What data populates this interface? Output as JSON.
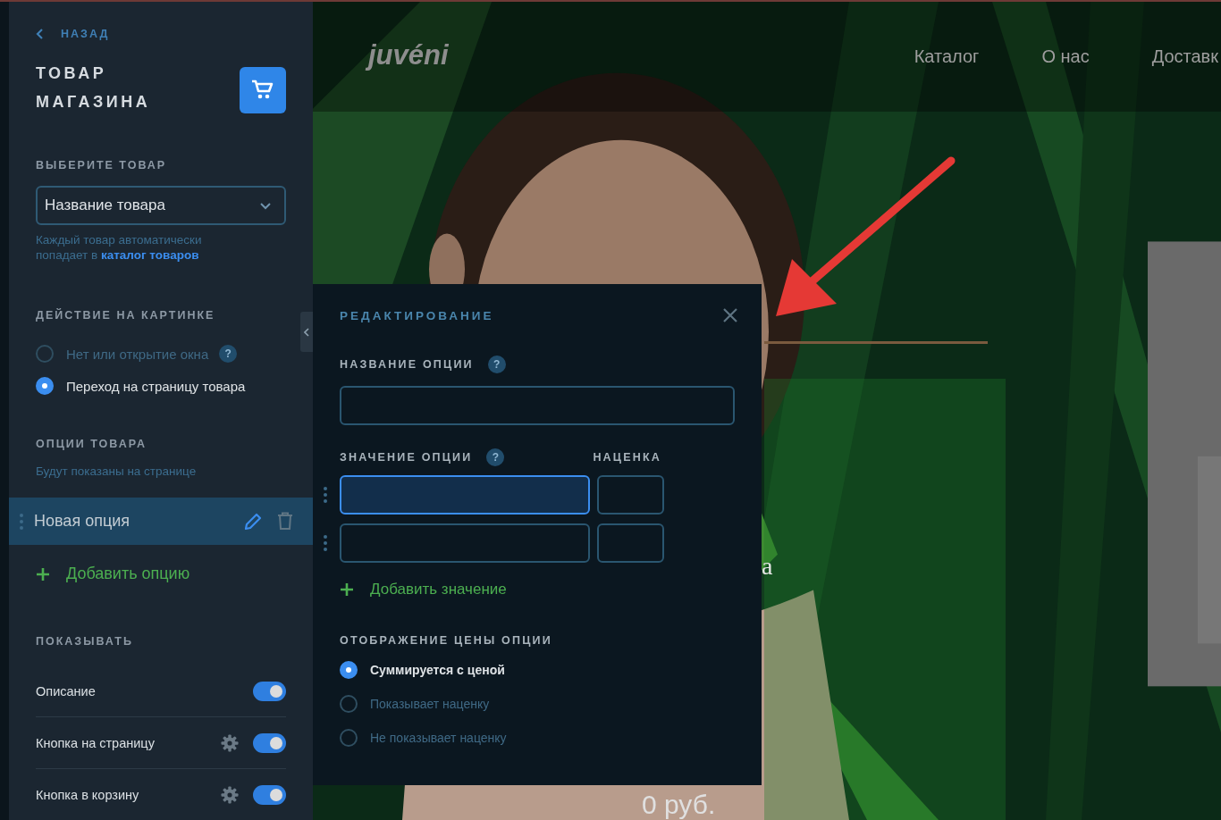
{
  "sidebar": {
    "back": "НАЗАД",
    "title": "ТОВАР МАГАЗИНА",
    "select_product": {
      "label": "ВЫБЕРИТЕ ТОВАР",
      "value": "Название товара",
      "hint": "Каждый товар автоматически попадает в",
      "hint_link": "каталог товаров"
    },
    "image_action": {
      "label": "ДЕЙСТВИЕ НА КАРТИНКЕ",
      "options": [
        {
          "label": "Нет или открытие окна",
          "selected": false,
          "help": "?"
        },
        {
          "label": "Переход на страницу товара",
          "selected": true
        }
      ]
    },
    "product_options": {
      "label": "ОПЦИИ ТОВАРА",
      "hint": "Будут показаны на странице",
      "items": [
        {
          "name": "Новая опция",
          "selected": true
        }
      ],
      "add": "Добавить опцию"
    },
    "show": {
      "label": "ПОКАЗЫВАТЬ",
      "toggles": [
        {
          "label": "Описание",
          "on": true,
          "settings": false
        },
        {
          "label": "Кнопка на страницу",
          "on": true,
          "settings": true
        },
        {
          "label": "Кнопка в корзину",
          "on": true,
          "settings": true
        }
      ]
    }
  },
  "preview": {
    "logo": "juvéni",
    "nav": [
      "Каталог",
      "О нас",
      "Доставк"
    ],
    "fragment": "а",
    "price": "0 руб."
  },
  "modal": {
    "title": "РЕДАКТИРОВАНИЕ",
    "name_label": "НАЗВАНИЕ ОПЦИИ",
    "name_help": "?",
    "value_label": "ЗНАЧЕНИЕ ОПЦИИ",
    "value_help": "?",
    "markup_label": "НАЦЕНКА",
    "value_rows": [
      {
        "focused": true
      },
      {
        "focused": false
      }
    ],
    "add_value": "Добавить значение",
    "price_label": "ОТОБРАЖЕНИЕ ЦЕНЫ ОПЦИИ",
    "price_options": [
      {
        "label": "Суммируется с ценой",
        "selected": true
      },
      {
        "label": "Показывает наценку",
        "selected": false
      },
      {
        "label": "Не показывает наценку",
        "selected": false
      }
    ]
  }
}
